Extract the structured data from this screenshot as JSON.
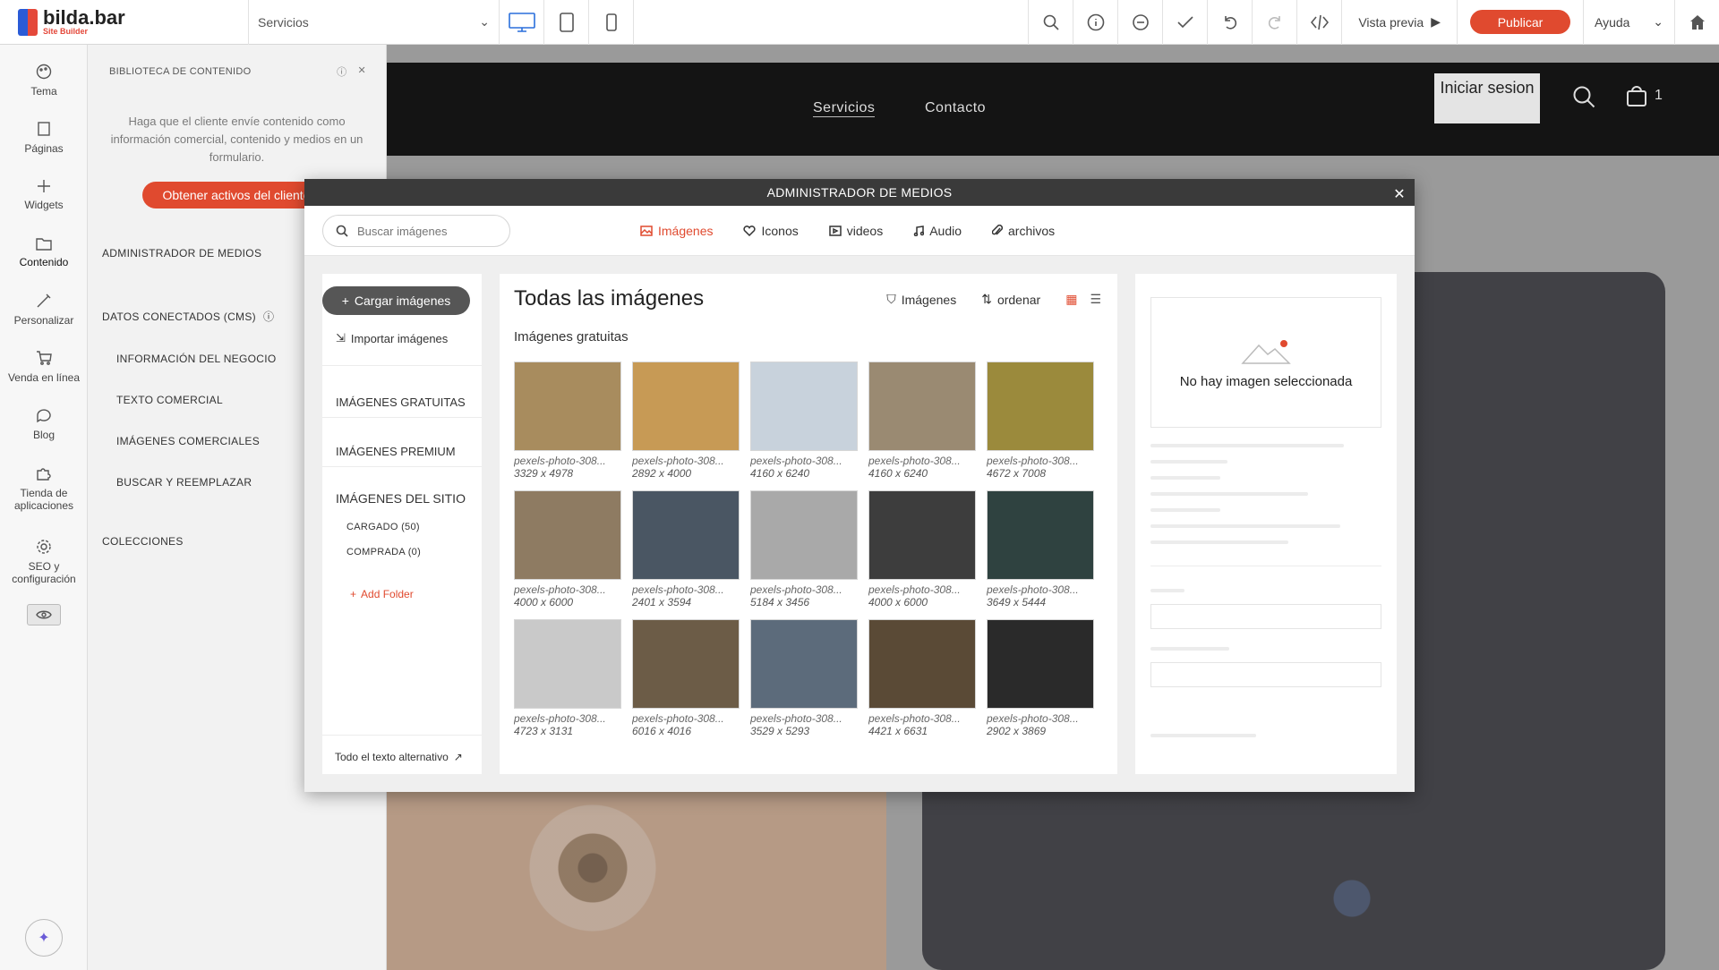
{
  "topbar": {
    "logo_name": "bilda.bar",
    "logo_sub": "Site Builder",
    "page_select": "Servicios",
    "preview": "Vista previa",
    "publish": "Publicar",
    "help": "Ayuda"
  },
  "leftnav": {
    "items": [
      {
        "label": "Tema",
        "icon": "palette-icon"
      },
      {
        "label": "Páginas",
        "icon": "pages-icon"
      },
      {
        "label": "Widgets",
        "icon": "plus-icon"
      },
      {
        "label": "Contenido",
        "icon": "folder-icon"
      },
      {
        "label": "Personalizar",
        "icon": "personalize-icon"
      },
      {
        "label": "Venda en línea",
        "icon": "cart-icon"
      },
      {
        "label": "Blog",
        "icon": "chat-icon"
      },
      {
        "label": "Tienda de aplicaciones",
        "icon": "puzzle-icon"
      },
      {
        "label": "SEO y configuración",
        "icon": "gear-icon"
      }
    ]
  },
  "library": {
    "title": "BIBLIOTECA DE CONTENIDO",
    "description": "Haga que el cliente envíe contenido como información comercial, contenido y medios en un formulario.",
    "button": "Obtener activos del cliente",
    "sections": {
      "media": "ADMINISTRADOR DE MEDIOS",
      "cms": "DATOS CONECTADOS (CMS)",
      "business": "INFORMACIÓN DEL NEGOCIO",
      "text": "TEXTO COMERCIAL",
      "images": "IMÁGENES COMERCIALES",
      "replace": "BUSCAR Y REEMPLAZAR",
      "collections": "COLECCIONES"
    }
  },
  "site": {
    "nav": [
      "Servicios",
      "Contacto"
    ],
    "login": "Iniciar sesion",
    "cart_count": "1"
  },
  "modal": {
    "title": "ADMINISTRADOR DE MEDIOS",
    "search_placeholder": "Buscar imágenes",
    "tabs": [
      "Imágenes",
      "Iconos",
      "videos",
      "Audio",
      "archivos"
    ],
    "side": {
      "upload": "Cargar imágenes",
      "import": "Importar imágenes",
      "free": "IMÁGENES GRATUITAS",
      "premium": "IMÁGENES PREMIUM",
      "site": "IMÁGENES DEL SITIO",
      "uploaded": "CARGADO (50)",
      "purchased": "COMPRADA (0)",
      "add_folder": "Add Folder",
      "alt_text": "Todo el texto alternativo"
    },
    "gallery": {
      "title": "Todas las imágenes",
      "filter": "Imágenes",
      "sort": "ordenar",
      "subtitle": "Imágenes gratuitas",
      "images": [
        {
          "name": "pexels-photo-308...",
          "size": "3329 x 4978",
          "color": "#a88c5e"
        },
        {
          "name": "pexels-photo-308...",
          "size": "2892 x 4000",
          "color": "#c79a55"
        },
        {
          "name": "pexels-photo-308...",
          "size": "4160 x 6240",
          "color": "#c8d2dc"
        },
        {
          "name": "pexels-photo-308...",
          "size": "4160 x 6240",
          "color": "#9a8a72"
        },
        {
          "name": "pexels-photo-308...",
          "size": "4672 x 7008",
          "color": "#9b8a3c"
        },
        {
          "name": "pexels-photo-308...",
          "size": "4000 x 6000",
          "color": "#8e7b62"
        },
        {
          "name": "pexels-photo-308...",
          "size": "2401 x 3594",
          "color": "#4a5663"
        },
        {
          "name": "pexels-photo-308...",
          "size": "5184 x 3456",
          "color": "#a9a9a9"
        },
        {
          "name": "pexels-photo-308...",
          "size": "4000 x 6000",
          "color": "#3d3d3d"
        },
        {
          "name": "pexels-photo-308...",
          "size": "3649 x 5444",
          "color": "#2f4240"
        },
        {
          "name": "pexels-photo-308...",
          "size": "4723 x 3131",
          "color": "#c9c9c9"
        },
        {
          "name": "pexels-photo-308...",
          "size": "6016 x 4016",
          "color": "#6c5c47"
        },
        {
          "name": "pexels-photo-308...",
          "size": "3529 x 5293",
          "color": "#5c6b7b"
        },
        {
          "name": "pexels-photo-308...",
          "size": "4421 x 6631",
          "color": "#5a4a36"
        },
        {
          "name": "pexels-photo-308...",
          "size": "2902 x 3869",
          "color": "#2a2a2a"
        }
      ]
    },
    "detail": {
      "empty": "No hay imagen seleccionada"
    }
  }
}
